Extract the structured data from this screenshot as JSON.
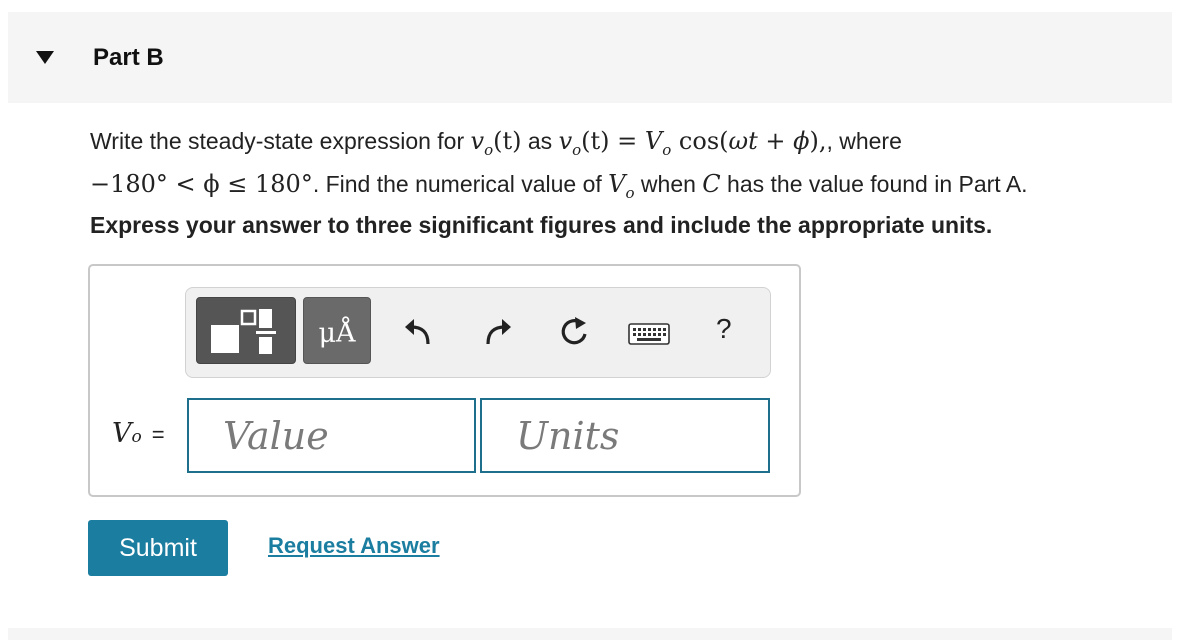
{
  "header": {
    "title": "Part B",
    "caret_icon": "caret-down-icon"
  },
  "prompt": {
    "line1_text_a": "Write the steady-state expression for ",
    "line1_text_b": " as ",
    "line1_text_c": ", where",
    "math_vo_t": "v",
    "math_vo_t_sub": "o",
    "math_vo_t_arg": "(t)",
    "math_eq_rhs_V": "V",
    "math_eq_rhs_sub": "o",
    "math_eq_rhs_cos": " cos(",
    "math_eq_rhs_arg": "ωt + ϕ",
    "math_eq_rhs_close": "),",
    "line2_math": "−180° < ϕ ≤ 180°",
    "line2_text_a": ". Find the numerical value of ",
    "line2_V": "V",
    "line2_V_sub": "o",
    "line2_text_b": " when ",
    "line2_C": "C",
    "line2_text_c": " has the value found in Part A."
  },
  "instruction": "Express your answer to three significant figures and include the appropriate units.",
  "toolbar": {
    "templates_icon": "templates-icon",
    "units_label": "μÅ",
    "undo_icon": "undo-icon",
    "redo_icon": "redo-icon",
    "reset_icon": "reset-icon",
    "keyboard_icon": "keyboard-icon",
    "help_label": "?"
  },
  "answer": {
    "variable": "V",
    "variable_sub": "o",
    "equals": "=",
    "value_placeholder": "Value",
    "units_placeholder": "Units"
  },
  "actions": {
    "submit_label": "Submit",
    "request_label": "Request Answer"
  },
  "colors": {
    "accent": "#1b7ea0",
    "field_border": "#1e6f8c",
    "header_bg": "#f5f5f5"
  }
}
